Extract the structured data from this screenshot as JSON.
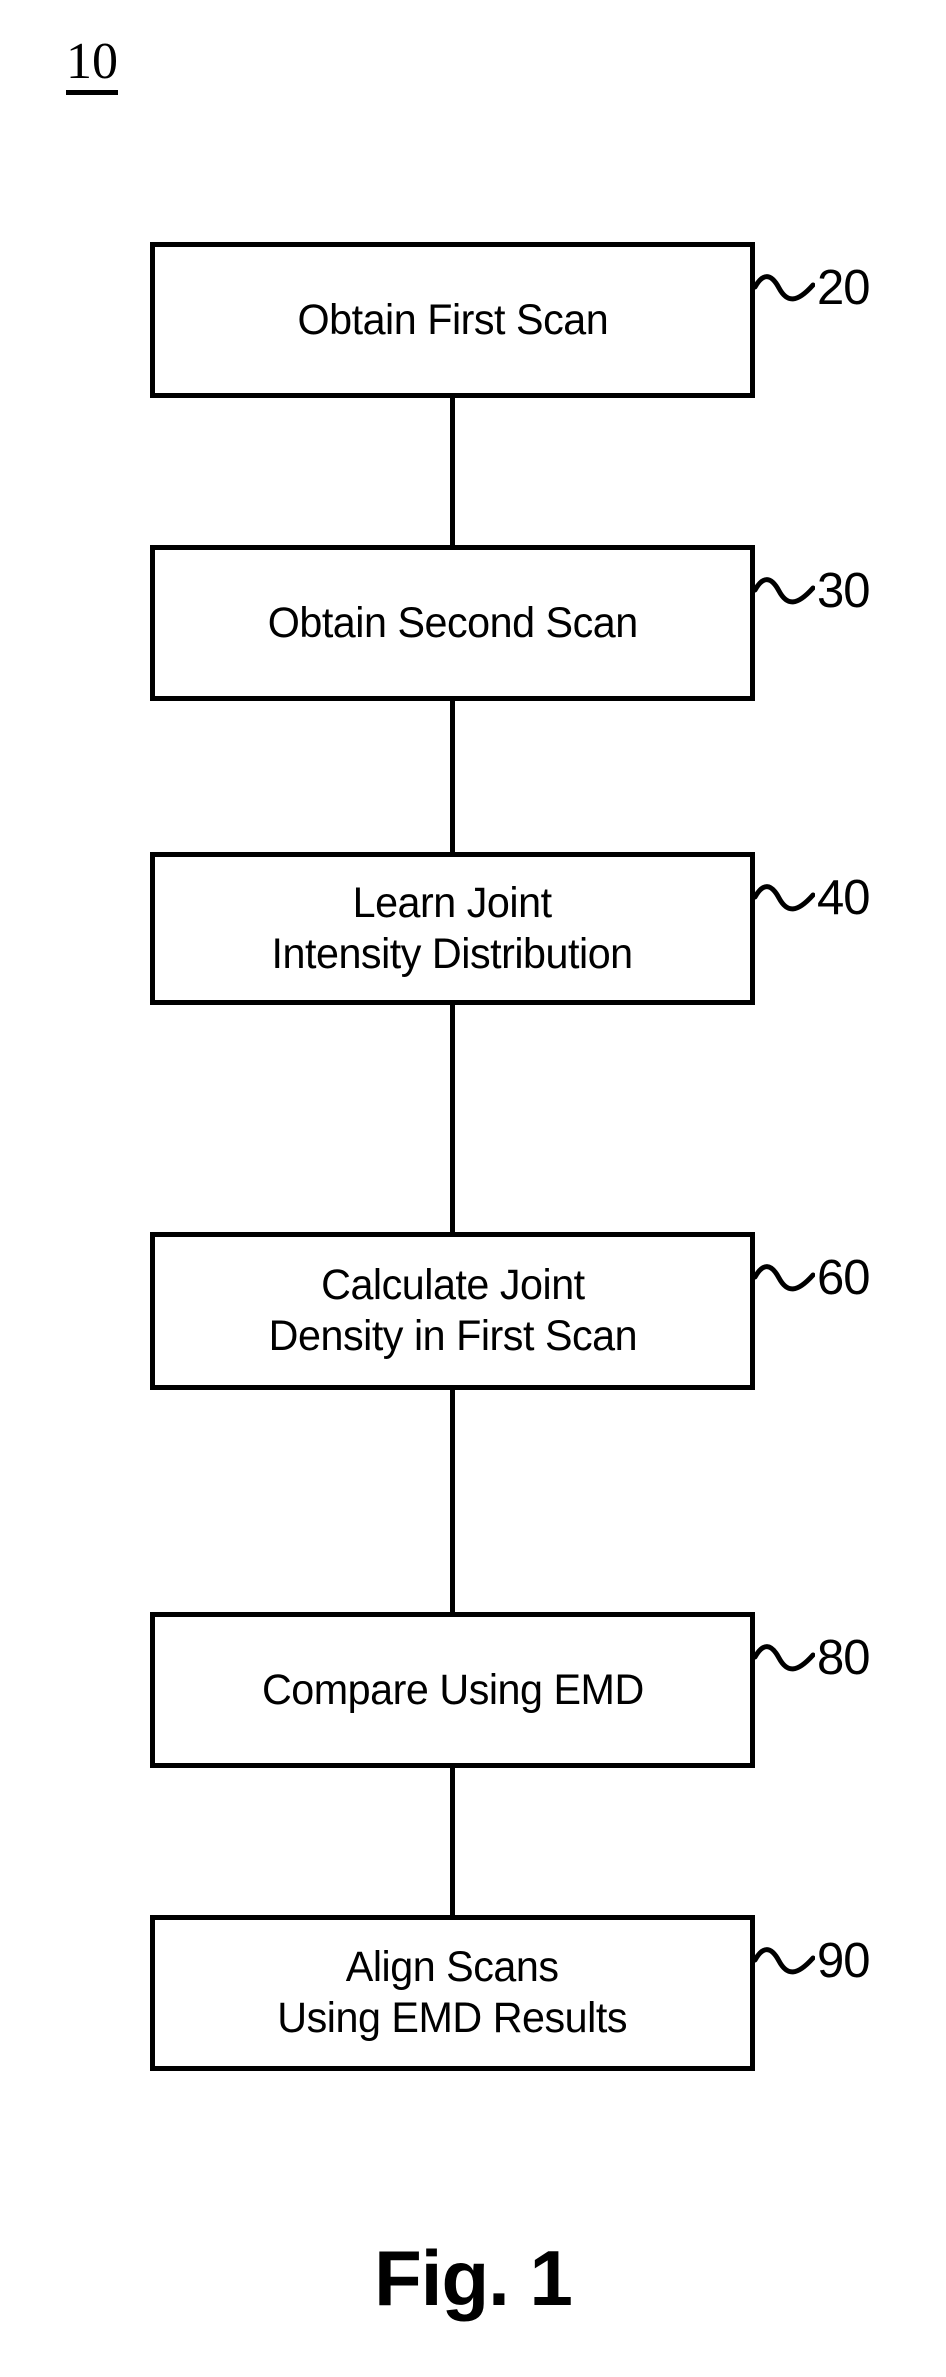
{
  "figure": {
    "reference_numeral": "10",
    "caption": "Fig. 1"
  },
  "flowchart": {
    "steps": [
      {
        "id": "step-20",
        "label": "Obtain First Scan",
        "ref": "20"
      },
      {
        "id": "step-30",
        "label": "Obtain Second Scan",
        "ref": "30"
      },
      {
        "id": "step-40",
        "label": "Learn Joint\nIntensity Distribution",
        "ref": "40"
      },
      {
        "id": "step-60",
        "label": "Calculate Joint\nDensity in First Scan",
        "ref": "60"
      },
      {
        "id": "step-80",
        "label": "Compare Using EMD",
        "ref": "80"
      },
      {
        "id": "step-90",
        "label": "Align Scans\nUsing EMD Results",
        "ref": "90"
      }
    ]
  },
  "colors": {
    "ink": "#000000",
    "paper": "#ffffff"
  }
}
